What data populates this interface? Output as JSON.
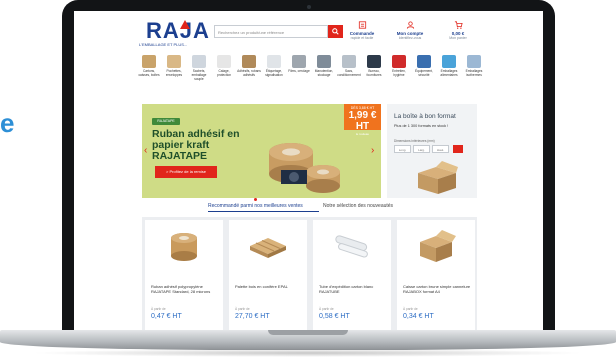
{
  "side_text": "e",
  "header": {
    "logo": "RAJA",
    "logo_tagline": "L'EMBALLAGE ET PLUS...",
    "search_placeholder": "Recherchez un produit/une référence",
    "order": {
      "label": "Commande",
      "sub": "rapide et facile"
    },
    "account": {
      "label": "Mon compte",
      "sub": "Identifiez-vous"
    },
    "cart": {
      "label": "0,00 €",
      "sub": "Mon panier"
    }
  },
  "categories": [
    {
      "label": "Cartons, caisses, boîtes",
      "color": "#c9a36a"
    },
    {
      "label": "Pochettes, enveloppes",
      "color": "#d9b886"
    },
    {
      "label": "Sachets, emballage souple",
      "color": "#cfd6de"
    },
    {
      "label": "Calage, protection",
      "color": "#e6e6e6"
    },
    {
      "label": "Adhésifs, rubans adhésifs",
      "color": "#b08a5a"
    },
    {
      "label": "Étiquetage, signalisation",
      "color": "#e0e4e8"
    },
    {
      "label": "Films, cerclage",
      "color": "#9ea6ae"
    },
    {
      "label": "Manutention, stockage",
      "color": "#7f8c99"
    },
    {
      "label": "Sacs, conditionnement",
      "color": "#b7c0c9"
    },
    {
      "label": "Bureau, fournitures",
      "color": "#2d3a4a"
    },
    {
      "label": "Entretien, hygiène",
      "color": "#d02b2b"
    },
    {
      "label": "Équipement, sécurité",
      "color": "#3a6fb0"
    },
    {
      "label": "Emballages alimentaires",
      "color": "#4aa3d9"
    },
    {
      "label": "Emballages isothermes",
      "color": "#9cb8d4"
    }
  ],
  "banner": {
    "brand_badge": "RAJATAPE",
    "title": "Ruban adhésif en papier kraft RAJATAPE",
    "cta": "> Profitez de la remise",
    "price_label": "DÈS 3,88 € HT",
    "price": "1,99 € HT",
    "price_unit": "le rouleau"
  },
  "box_format": {
    "title": "La boîte à bon format",
    "subtitle": "Plus de 1 300 formats en stock !",
    "label": "Dimensions intérieures (mm)",
    "inputs": [
      "Long.",
      "Larg.",
      "Haut."
    ]
  },
  "tabs": [
    "Recommandé parmi nos meilleures ventes",
    "Notre sélection des nouveautés"
  ],
  "products": [
    {
      "desc": "Ruban adhésif polypropylène RAJATAPE Standard, 28 microns",
      "from": "À partir de",
      "price": "0,47 € HT"
    },
    {
      "desc": "Palette bois en conifère EPAL",
      "from": "À partir de",
      "price": "27,70 € HT"
    },
    {
      "desc": "Tube d'expédition carton blanc RAJATUBE",
      "from": "À partir de",
      "price": "0,58 € HT"
    },
    {
      "desc": "Caisse carton brune simple cannelure RAJABOX format A4",
      "from": "À partir de",
      "price": "0,34 € HT"
    }
  ],
  "colors": {
    "brand_blue": "#1c3f8f",
    "brand_red": "#e1251b",
    "banner_green": "#cfdc86",
    "promo_orange": "#f0731e",
    "price_blue": "#2b6cc4"
  }
}
